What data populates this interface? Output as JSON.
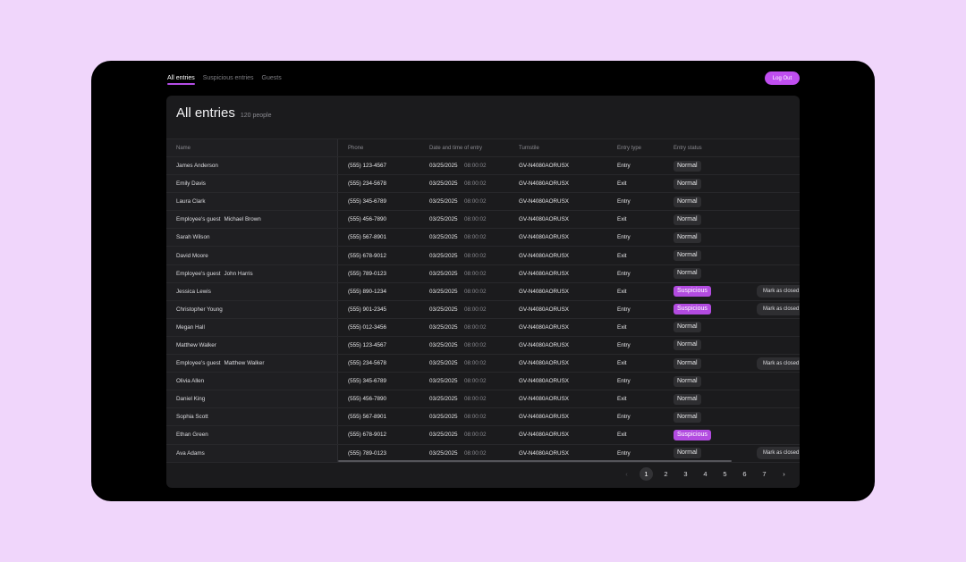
{
  "nav": {
    "tabs": [
      {
        "label": "All entries",
        "active": true
      },
      {
        "label": "Suspicious entries",
        "active": false
      },
      {
        "label": "Guests",
        "active": false
      }
    ],
    "logout_label": "Log Out"
  },
  "page": {
    "title": "All entries",
    "count": "120 people"
  },
  "table": {
    "columns": {
      "name": "Name",
      "phone": "Phone",
      "datetime": "Date and time of entry",
      "turnstile": "Turnstile",
      "type": "Entry type",
      "status": "Entry status"
    },
    "mark_label": "Mark as closed",
    "rows": [
      {
        "guest": "",
        "name": "James Anderson",
        "phone": "(555) 123-4567",
        "date": "03/25/2025",
        "time": "08:00:02",
        "turnstile": "GV-N4080AORUSX",
        "type": "Entry",
        "status": "Normal",
        "action": false
      },
      {
        "guest": "",
        "name": "Emily Davis",
        "phone": "(555) 234-5678",
        "date": "03/25/2025",
        "time": "08:00:02",
        "turnstile": "GV-N4080AORUSX",
        "type": "Exit",
        "status": "Normal",
        "action": false
      },
      {
        "guest": "",
        "name": "Laura Clark",
        "phone": "(555) 345-6789",
        "date": "03/25/2025",
        "time": "08:00:02",
        "turnstile": "GV-N4080AORUSX",
        "type": "Entry",
        "status": "Normal",
        "action": false
      },
      {
        "guest": "Employee's guest",
        "name": "Michael Brown",
        "phone": "(555) 456-7890",
        "date": "03/25/2025",
        "time": "08:00:02",
        "turnstile": "GV-N4080AORUSX",
        "type": "Exit",
        "status": "Normal",
        "action": false
      },
      {
        "guest": "",
        "name": "Sarah Wilson",
        "phone": "(555) 567-8901",
        "date": "03/25/2025",
        "time": "08:00:02",
        "turnstile": "GV-N4080AORUSX",
        "type": "Entry",
        "status": "Normal",
        "action": false
      },
      {
        "guest": "",
        "name": "David Moore",
        "phone": "(555) 678-9012",
        "date": "03/25/2025",
        "time": "08:00:02",
        "turnstile": "GV-N4080AORUSX",
        "type": "Exit",
        "status": "Normal",
        "action": false
      },
      {
        "guest": "Employee's guest",
        "name": "John Harris",
        "phone": "(555) 789-0123",
        "date": "03/25/2025",
        "time": "08:00:02",
        "turnstile": "GV-N4080AORUSX",
        "type": "Entry",
        "status": "Normal",
        "action": false
      },
      {
        "guest": "",
        "name": "Jessica Lewis",
        "phone": "(555) 890-1234",
        "date": "03/25/2025",
        "time": "08:00:02",
        "turnstile": "GV-N4080AORUSX",
        "type": "Exit",
        "status": "Suspicious",
        "action": true
      },
      {
        "guest": "",
        "name": "Christopher Young",
        "phone": "(555) 901-2345",
        "date": "03/25/2025",
        "time": "08:00:02",
        "turnstile": "GV-N4080AORUSX",
        "type": "Entry",
        "status": "Suspicious",
        "action": true
      },
      {
        "guest": "",
        "name": "Megan Hall",
        "phone": "(555) 012-3456",
        "date": "03/25/2025",
        "time": "08:00:02",
        "turnstile": "GV-N4080AORUSX",
        "type": "Exit",
        "status": "Normal",
        "action": false
      },
      {
        "guest": "",
        "name": "Matthew Walker",
        "phone": "(555) 123-4567",
        "date": "03/25/2025",
        "time": "08:00:02",
        "turnstile": "GV-N4080AORUSX",
        "type": "Entry",
        "status": "Normal",
        "action": false
      },
      {
        "guest": "Employee's guest",
        "name": "Matthew Walker",
        "phone": "(555) 234-5678",
        "date": "03/25/2025",
        "time": "08:00:02",
        "turnstile": "GV-N4080AORUSX",
        "type": "Exit",
        "status": "Normal",
        "action": true
      },
      {
        "guest": "",
        "name": "Olivia Allen",
        "phone": "(555) 345-6789",
        "date": "03/25/2025",
        "time": "08:00:02",
        "turnstile": "GV-N4080AORUSX",
        "type": "Entry",
        "status": "Normal",
        "action": false
      },
      {
        "guest": "",
        "name": "Daniel King",
        "phone": "(555) 456-7890",
        "date": "03/25/2025",
        "time": "08:00:02",
        "turnstile": "GV-N4080AORUSX",
        "type": "Exit",
        "status": "Normal",
        "action": false
      },
      {
        "guest": "",
        "name": "Sophia Scott",
        "phone": "(555) 567-8901",
        "date": "03/25/2025",
        "time": "08:00:02",
        "turnstile": "GV-N4080AORUSX",
        "type": "Entry",
        "status": "Normal",
        "action": false
      },
      {
        "guest": "",
        "name": "Ethan Green",
        "phone": "(555) 678-9012",
        "date": "03/25/2025",
        "time": "08:00:02",
        "turnstile": "GV-N4080AORUSX",
        "type": "Exit",
        "status": "Suspicious",
        "action": false
      },
      {
        "guest": "",
        "name": "Ava Adams",
        "phone": "(555) 789-0123",
        "date": "03/25/2025",
        "time": "08:00:02",
        "turnstile": "GV-N4080AORUSX",
        "type": "Entry",
        "status": "Normal",
        "action": true
      }
    ]
  },
  "pagination": {
    "prev_icon": "‹",
    "next_icon": "›",
    "pages": [
      "1",
      "2",
      "3",
      "4",
      "5",
      "6",
      "7"
    ],
    "current": "1"
  },
  "colors": {
    "background": "#f0d6fb",
    "accent": "#c04ef0",
    "suspicious": "#b24be0",
    "panel": "#1b1b1d"
  }
}
